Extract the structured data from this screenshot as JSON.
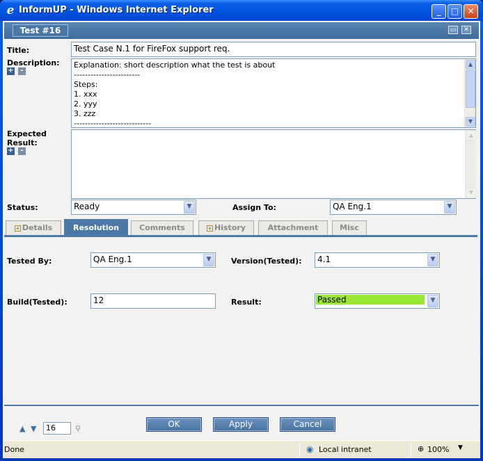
{
  "window": {
    "title": "InformUP - Windows Internet Explorer",
    "icon": "ie-icon",
    "controls": {
      "minimize": "_",
      "maximize": "□",
      "close": "✕"
    }
  },
  "header": {
    "tab_title": "Test #16"
  },
  "form": {
    "title_label": "Title:",
    "title_value": "Test Case N.1 for FireFox support req.",
    "description_label": "Description:",
    "description_lines": [
      "Explanation: short description what the test is about",
      "------------------------",
      "Steps:",
      "1. xxx",
      "2. yyy",
      "3. zzz",
      "----------------------------"
    ],
    "expected_label_1": "Expected",
    "expected_label_2": "Result:",
    "expected_value": "",
    "status_label": "Status:",
    "status_value": "Ready",
    "assign_label": "Assign To:",
    "assign_value": "QA Eng.1"
  },
  "tabs": [
    {
      "label": "Details",
      "expandable": true,
      "active": false
    },
    {
      "label": "Resolution",
      "expandable": false,
      "active": true
    },
    {
      "label": "Comments",
      "expandable": false,
      "active": false
    },
    {
      "label": "History",
      "expandable": true,
      "active": false
    },
    {
      "label": "Attachment",
      "expandable": false,
      "active": false
    },
    {
      "label": "Misc",
      "expandable": false,
      "active": false
    }
  ],
  "resolution": {
    "tested_by_label": "Tested By:",
    "tested_by_value": "QA Eng.1",
    "version_label": "Version(Tested):",
    "version_value": "4.1",
    "build_label": "Build(Tested):",
    "build_value": "12",
    "result_label": "Result:",
    "result_value": "Passed",
    "result_color": "#9be634"
  },
  "footer": {
    "record_number": "16",
    "ok_label": "OK",
    "apply_label": "Apply",
    "cancel_label": "Cancel"
  },
  "statusbar": {
    "status_text": "Done",
    "zone_text": "Local intranet",
    "zoom_text": "100%"
  },
  "colors": {
    "accent": "#4c78a8",
    "titlebar": "#0a5fe6"
  }
}
